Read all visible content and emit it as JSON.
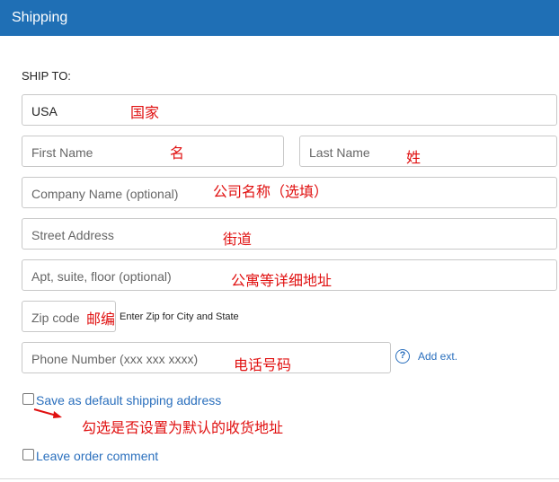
{
  "header": {
    "title": "Shipping"
  },
  "ship_to_label": "SHIP TO:",
  "country": {
    "value": "USA",
    "note": "国家"
  },
  "first_name": {
    "placeholder": "First Name",
    "note": "名"
  },
  "last_name": {
    "placeholder": "Last Name",
    "note": "姓"
  },
  "company": {
    "placeholder": "Company Name (optional)",
    "note": "公司名称（选填）"
  },
  "street": {
    "placeholder": "Street Address",
    "note": "街道"
  },
  "apt": {
    "placeholder": "Apt, suite, floor (optional)",
    "note": "公寓等详细地址"
  },
  "zip": {
    "placeholder": "Zip code",
    "note": "邮编",
    "hint": "Enter Zip for City and State"
  },
  "phone": {
    "placeholder": "Phone Number (xxx xxx xxxx)",
    "note": "电话号码",
    "help": "?",
    "add_ext": "Add ext."
  },
  "default_address": {
    "label": "Save as default shipping address",
    "note": "勾选是否设置为默认的收货地址"
  },
  "order_comment": {
    "label": "Leave order comment"
  }
}
